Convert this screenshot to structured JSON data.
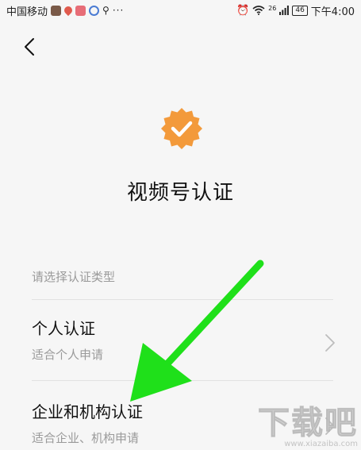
{
  "status_bar": {
    "carrier": "中国移动",
    "dots": "···",
    "signal_label": "26",
    "battery": "46",
    "time": "下午4:00"
  },
  "header": {
    "back_icon": "chevron-left-icon"
  },
  "badge": {
    "icon": "verified-badge-icon",
    "color": "#f39a3b"
  },
  "page": {
    "title": "视频号认证",
    "section_label": "请选择认证类型"
  },
  "options": [
    {
      "title": "个人认证",
      "desc": "适合个人申请"
    },
    {
      "title": "企业和机构认证",
      "desc": "适合企业、机构申请"
    }
  ],
  "watermark": {
    "main": "下载吧",
    "sub": "www.xiazaiba.com"
  },
  "colors": {
    "background": "#f6f6f6",
    "arrow": "#1fe01a",
    "badge": "#f39a3b"
  }
}
